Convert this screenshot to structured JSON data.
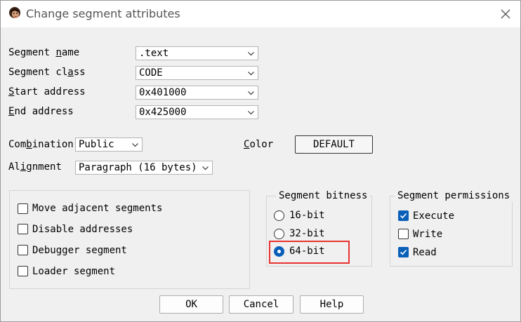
{
  "window": {
    "title": "Change segment attributes"
  },
  "fields": {
    "segment_name": {
      "label_pre": "Segment ",
      "label_u": "n",
      "label_post": "ame",
      "value": ".text"
    },
    "segment_class": {
      "label_pre": "Segment cl",
      "label_u": "a",
      "label_post": "ss",
      "value": "CODE"
    },
    "start_address": {
      "label_pre": "",
      "label_u": "S",
      "label_post": "tart address",
      "value": "0x401000"
    },
    "end_address": {
      "label_pre": "",
      "label_u": "E",
      "label_post": "nd address",
      "value": "0x425000"
    },
    "combination": {
      "label_pre": "Com",
      "label_u": "b",
      "label_post": "ination",
      "value": "Public"
    },
    "alignment": {
      "label_pre": "Al",
      "label_u": "i",
      "label_post": "gnment",
      "value": "Paragraph (16 bytes)"
    },
    "color": {
      "label_pre": "",
      "label_u": "C",
      "label_post": "olor",
      "button": "DEFAULT"
    }
  },
  "options": [
    {
      "label": "Move adjacent segments",
      "checked": true
    },
    {
      "label": "Disable addresses",
      "checked": false
    },
    {
      "label": "Debugger segment",
      "checked": false
    },
    {
      "label": "Loader segment",
      "checked": true
    }
  ],
  "bitness": {
    "title": "Segment bitness",
    "choices": [
      {
        "label": "16-bit",
        "selected": false
      },
      {
        "label": "32-bit",
        "selected": false
      },
      {
        "label": "64-bit",
        "selected": true
      }
    ]
  },
  "permissions": {
    "title": "Segment permissions",
    "items": [
      {
        "label": "Execute",
        "checked": true
      },
      {
        "label": "Write",
        "checked": false
      },
      {
        "label": "Read",
        "checked": true
      }
    ]
  },
  "buttons": {
    "ok": "OK",
    "cancel": "Cancel",
    "help": "Help"
  },
  "colors": {
    "accent": "#0a5fb8",
    "highlight": "#e8332f"
  }
}
